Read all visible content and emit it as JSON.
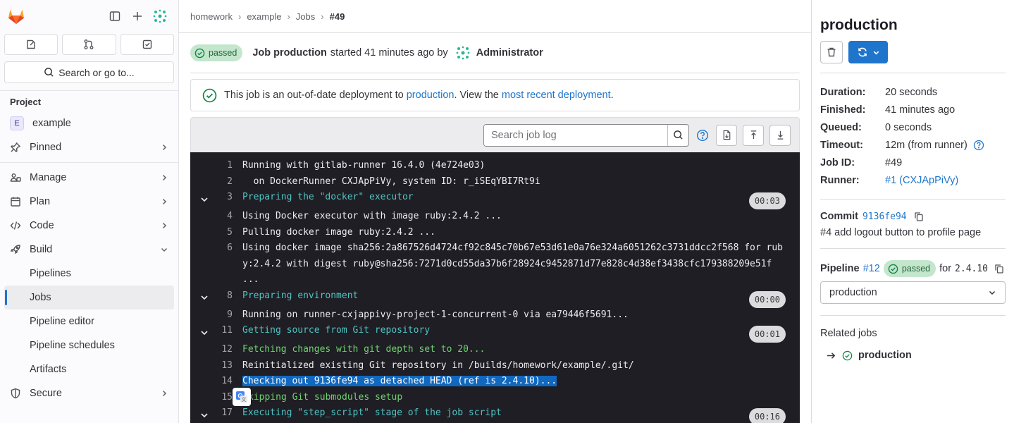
{
  "sidebar": {
    "search_label": "Search or go to...",
    "section_title": "Project",
    "project": {
      "avatar_letter": "E",
      "name": "example"
    },
    "items": [
      {
        "label": "Pinned"
      },
      {
        "label": "Manage"
      },
      {
        "label": "Plan"
      },
      {
        "label": "Code"
      },
      {
        "label": "Build"
      }
    ],
    "build_sub": [
      "Pipelines",
      "Jobs",
      "Pipeline editor",
      "Pipeline schedules",
      "Artifacts"
    ],
    "after": [
      {
        "label": "Secure"
      }
    ]
  },
  "breadcrumb": {
    "items": [
      "homework",
      "example",
      "Jobs"
    ],
    "current": "#49"
  },
  "job_header": {
    "status": "passed",
    "job_label": "Job production",
    "started_text": "started 41 minutes ago by",
    "user": "Administrator"
  },
  "alert": {
    "text1": "This job is an out-of-date deployment to",
    "env_link": "production",
    "text2": ". View the",
    "recent_link": "most recent deployment",
    "text3": "."
  },
  "log_toolbar": {
    "search_placeholder": "Search job log"
  },
  "log": [
    {
      "n": "1",
      "text": "Running with gitlab-runner 16.4.0 (4e724e03)"
    },
    {
      "n": "2",
      "text": "  on DockerRunner CXJApPiVy, system ID: r_iSEqYBI7Rt9i"
    },
    {
      "n": "3",
      "text": "Preparing the \"docker\" executor",
      "duration": "00:03"
    },
    {
      "n": "4",
      "text": "Using Docker executor with image ruby:2.4.2 ..."
    },
    {
      "n": "5",
      "text": "Pulling docker image ruby:2.4.2 ..."
    },
    {
      "n": "6",
      "text": "Using docker image sha256:2a867526d4724cf92c845c70b67e53d61e0a76e324a6051262c3731ddcc2f568 for ruby:2.4.2 with digest ruby@sha256:7271d0cd55da37b6f28924c9452871d77e828c4d38ef3438cfc179388209e51f ..."
    },
    {
      "n": "8",
      "text": "Preparing environment",
      "duration": "00:00"
    },
    {
      "n": "9",
      "text": "Running on runner-cxjappivy-project-1-concurrent-0 via ea79446f5691..."
    },
    {
      "n": "11",
      "text": "Getting source from Git repository",
      "duration": "00:01"
    },
    {
      "n": "12",
      "text": "Fetching changes with git depth set to 20..."
    },
    {
      "n": "13",
      "text": "Reinitialized existing Git repository in /builds/homework/example/.git/"
    },
    {
      "n": "14",
      "text": "Checking out 9136fe94 as detached HEAD (ref is 2.4.10)..."
    },
    {
      "n": "15",
      "text": "kipping Git submodules setup"
    },
    {
      "n": "17",
      "text": "Executing \"step_script\" stage of the job script",
      "duration": "00:16"
    }
  ],
  "right": {
    "title": "production",
    "details": [
      {
        "k": "Duration:",
        "v": "20 seconds"
      },
      {
        "k": "Finished:",
        "v": "41 minutes ago"
      },
      {
        "k": "Queued:",
        "v": "0 seconds"
      },
      {
        "k": "Timeout:",
        "v": "12m (from runner)"
      },
      {
        "k": "Job ID:",
        "v": "#49"
      },
      {
        "k": "Runner:",
        "v": "#1 (CXJApPiVy)"
      }
    ],
    "commit": {
      "label": "Commit",
      "sha": "9136fe94",
      "message": "#4 add logout button to profile page"
    },
    "pipeline": {
      "label": "Pipeline",
      "id": "#12",
      "status": "passed",
      "for_text": "for",
      "ref": "2.4.10",
      "select_value": "production"
    },
    "related": {
      "title": "Related jobs",
      "job": "production"
    }
  },
  "colors": {
    "accent": "#1f75cb",
    "success": "#108548",
    "log_bg": "#1f1e24"
  }
}
